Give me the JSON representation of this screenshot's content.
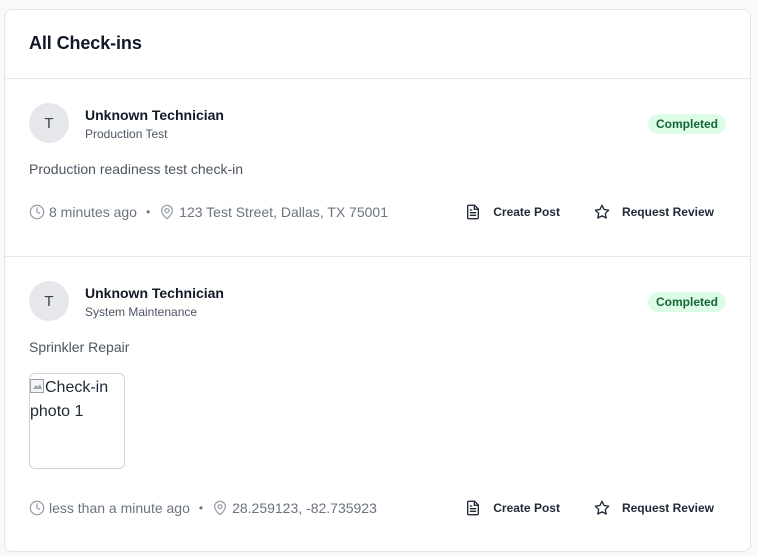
{
  "page": {
    "title": "All Check-ins"
  },
  "checkins": [
    {
      "avatar_initial": "T",
      "technician": "Unknown Technician",
      "job_type": "Production Test",
      "status": "Completed",
      "description": "Production readiness test check-in",
      "time_ago": "8 minutes ago",
      "location": "123 Test Street, Dallas, TX 75001",
      "separator": "•",
      "create_post_label": "Create Post",
      "request_review_label": "Request Review"
    },
    {
      "avatar_initial": "T",
      "technician": "Unknown Technician",
      "job_type": "System Maintenance",
      "status": "Completed",
      "description": "Sprinkler Repair",
      "photo_alt": "Check-in photo 1",
      "time_ago": "less than a minute ago",
      "location": "28.259123, -82.735923",
      "separator": "•",
      "create_post_label": "Create Post",
      "request_review_label": "Request Review"
    }
  ],
  "colors": {
    "badge_bg": "#dcfce7",
    "badge_text": "#166534",
    "avatar_bg": "#e5e7eb"
  },
  "icons": {
    "time": "clock-icon",
    "location": "map-pin-icon",
    "create_post": "document-icon",
    "request_review": "star-icon"
  }
}
